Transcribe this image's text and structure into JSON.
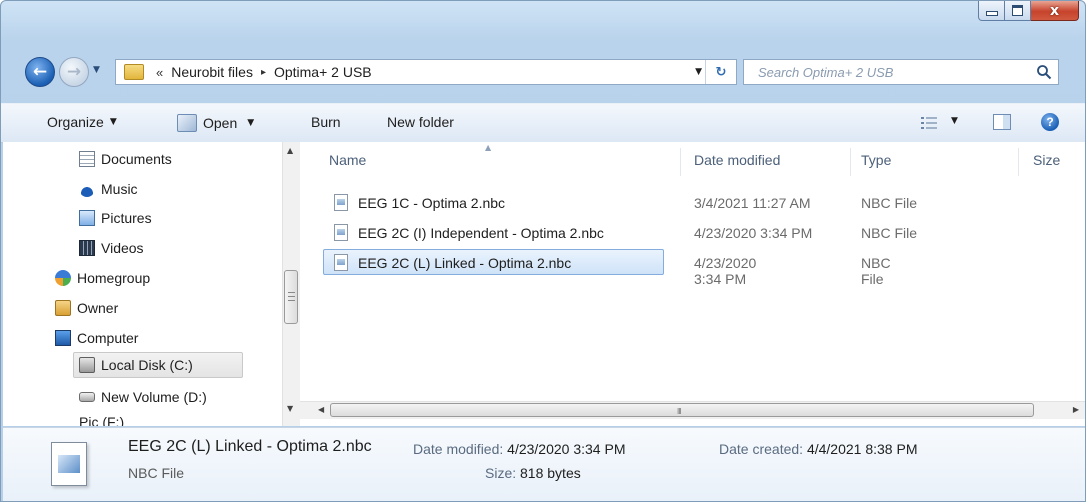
{
  "window": {
    "controls": {
      "minimize_icon": "minimize-icon",
      "maximize_icon": "maximize-icon",
      "close_glyph": "x"
    }
  },
  "address": {
    "overflow_chevrons": "«",
    "crumbs": [
      "Neurobit files",
      "Optima+ 2 USB"
    ],
    "separator": "▸",
    "search_placeholder": "Search Optima+ 2 USB"
  },
  "toolbar": {
    "organize": "Organize",
    "open": "Open",
    "burn": "Burn",
    "new_folder": "New folder",
    "help_glyph": "?"
  },
  "navigation": {
    "items": [
      {
        "label": "Documents",
        "icon": "documents-icon"
      },
      {
        "label": "Music",
        "icon": "music-icon"
      },
      {
        "label": "Pictures",
        "icon": "pictures-icon"
      },
      {
        "label": "Videos",
        "icon": "videos-icon"
      },
      {
        "label": "Homegroup",
        "icon": "homegroup-icon"
      },
      {
        "label": "Owner",
        "icon": "owner-icon"
      },
      {
        "label": "Computer",
        "icon": "computer-icon"
      },
      {
        "label": "Local Disk (C:)",
        "icon": "local-disk-icon",
        "selected": true
      },
      {
        "label": "New Volume (D:)",
        "icon": "volume-icon"
      }
    ],
    "partial_item": "Pic (F:)"
  },
  "file_list": {
    "columns": [
      "Name",
      "Date modified",
      "Type",
      "Size"
    ],
    "rows": [
      {
        "name": "EEG 1C - Optima 2.nbc",
        "date": "3/4/2021 11:27 AM",
        "type": "NBC File"
      },
      {
        "name": "EEG 2C (I) Independent - Optima 2.nbc",
        "date": "4/23/2020 3:34 PM",
        "type": "NBC File"
      },
      {
        "name": "EEG 2C (L) Linked - Optima 2.nbc",
        "date": "4/23/2020 3:34 PM",
        "type": "NBC File",
        "selected": true
      }
    ],
    "hscroll_grip": "III"
  },
  "details": {
    "name": "EEG 2C (L) Linked - Optima 2.nbc",
    "type": "NBC File",
    "date_modified_label": "Date modified:",
    "date_modified": "4/23/2020 3:34 PM",
    "size_label": "Size:",
    "size": "818 bytes",
    "date_created_label": "Date created:",
    "date_created": "4/4/2021 8:38 PM"
  },
  "colors": {
    "accent": "#1a5fb4",
    "selection": "#cfe3f8",
    "chrome": "#b9d3ec"
  }
}
